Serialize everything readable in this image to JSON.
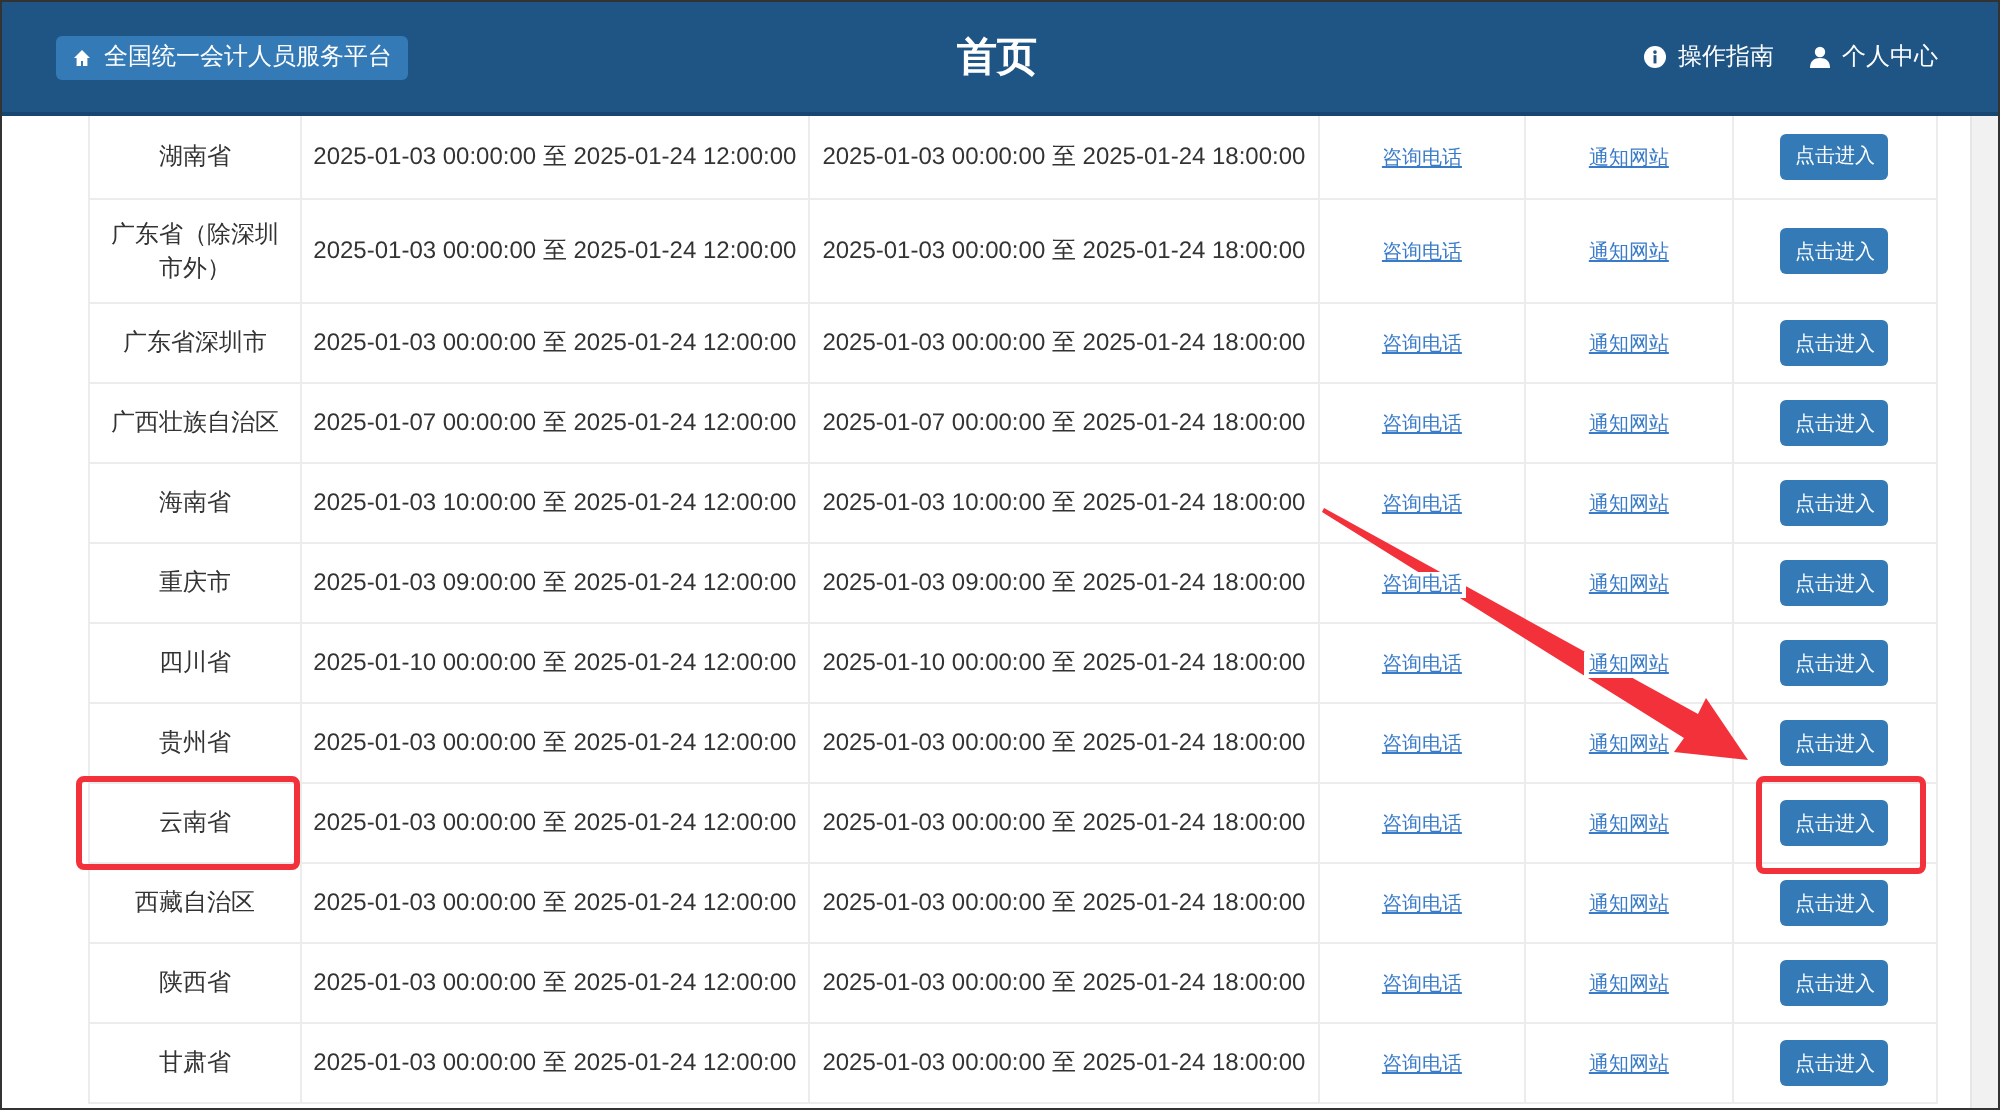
{
  "header": {
    "platform_button": "全国统一会计人员服务平台",
    "title": "首页",
    "links": [
      {
        "kind": "guide",
        "label": "操作指南"
      },
      {
        "kind": "user",
        "label": "个人中心"
      }
    ]
  },
  "rows": [
    {
      "region": "湖南省",
      "column_2": "2025-01-03 00:00:00 至 2025-01-24 12:00:00",
      "column_3": "2025-01-03 00:00:00 至 2025-01-24 18:00:00",
      "phone_link": "咨询电话",
      "site_link": "通知网站",
      "button": "点击进入",
      "highlighted": false
    },
    {
      "region": "广东省（除深圳市外）",
      "column_2": "2025-01-03 00:00:00 至 2025-01-24 12:00:00",
      "column_3": "2025-01-03 00:00:00 至 2025-01-24 18:00:00",
      "phone_link": "咨询电话",
      "site_link": "通知网站",
      "button": "点击进入",
      "highlighted": false
    },
    {
      "region": "广东省深圳市",
      "column_2": "2025-01-03 00:00:00 至 2025-01-24 12:00:00",
      "column_3": "2025-01-03 00:00:00 至 2025-01-24 18:00:00",
      "phone_link": "咨询电话",
      "site_link": "通知网站",
      "button": "点击进入",
      "highlighted": false
    },
    {
      "region": "广西壮族自治区",
      "column_2": "2025-01-07 00:00:00 至 2025-01-24 12:00:00",
      "column_3": "2025-01-07 00:00:00 至 2025-01-24 18:00:00",
      "phone_link": "咨询电话",
      "site_link": "通知网站",
      "button": "点击进入",
      "highlighted": false
    },
    {
      "region": "海南省",
      "column_2": "2025-01-03 10:00:00 至 2025-01-24 12:00:00",
      "column_3": "2025-01-03 10:00:00 至 2025-01-24 18:00:00",
      "phone_link": "咨询电话",
      "site_link": "通知网站",
      "button": "点击进入",
      "highlighted": false
    },
    {
      "region": "重庆市",
      "column_2": "2025-01-03 09:00:00 至 2025-01-24 12:00:00",
      "column_3": "2025-01-03 09:00:00 至 2025-01-24 18:00:00",
      "phone_link": "咨询电话",
      "site_link": "通知网站",
      "button": "点击进入",
      "highlighted": false
    },
    {
      "region": "四川省",
      "column_2": "2025-01-10 00:00:00 至 2025-01-24 12:00:00",
      "column_3": "2025-01-10 00:00:00 至 2025-01-24 18:00:00",
      "phone_link": "咨询电话",
      "site_link": "通知网站",
      "button": "点击进入",
      "highlighted": false
    },
    {
      "region": "贵州省",
      "column_2": "2025-01-03 00:00:00 至 2025-01-24 12:00:00",
      "column_3": "2025-01-03 00:00:00 至 2025-01-24 18:00:00",
      "phone_link": "咨询电话",
      "site_link": "通知网站",
      "button": "点击进入",
      "highlighted": false
    },
    {
      "region": "云南省",
      "column_2": "2025-01-03 00:00:00 至 2025-01-24 12:00:00",
      "column_3": "2025-01-03 00:00:00 至 2025-01-24 18:00:00",
      "phone_link": "咨询电话",
      "site_link": "通知网站",
      "button": "点击进入",
      "highlighted": true
    },
    {
      "region": "西藏自治区",
      "column_2": "2025-01-03 00:00:00 至 2025-01-24 12:00:00",
      "column_3": "2025-01-03 00:00:00 至 2025-01-24 18:00:00",
      "phone_link": "咨询电话",
      "site_link": "通知网站",
      "button": "点击进入",
      "highlighted": false
    },
    {
      "region": "陕西省",
      "column_2": "2025-01-03 00:00:00 至 2025-01-24 12:00:00",
      "column_3": "2025-01-03 00:00:00 至 2025-01-24 18:00:00",
      "phone_link": "咨询电话",
      "site_link": "通知网站",
      "button": "点击进入",
      "highlighted": false
    },
    {
      "region": "甘肃省",
      "column_2": "2025-01-03 00:00:00 至 2025-01-24 12:00:00",
      "column_3": "2025-01-03 00:00:00 至 2025-01-24 18:00:00",
      "phone_link": "咨询电话",
      "site_link": "通知网站",
      "button": "点击进入",
      "highlighted": false
    }
  ]
}
